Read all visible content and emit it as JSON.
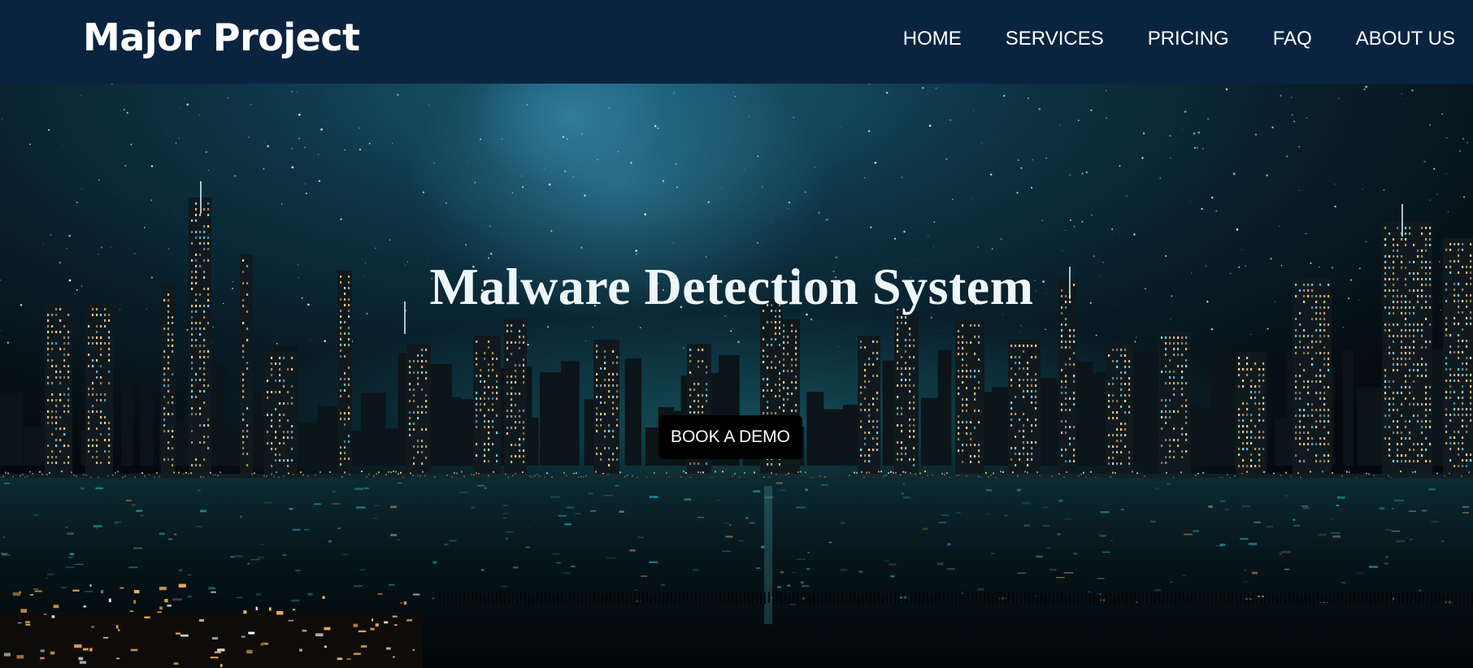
{
  "navbar": {
    "brand": "Major Project",
    "links": [
      {
        "label": "HOME"
      },
      {
        "label": "SERVICES"
      },
      {
        "label": "PRICING"
      },
      {
        "label": "FAQ"
      },
      {
        "label": "ABOUT US"
      }
    ]
  },
  "hero": {
    "title": "Malware Detection System",
    "cta_label": "BOOK A DEMO",
    "background_image": "night-city-skyline-photo"
  },
  "colors": {
    "navbar_bg": "#0a2440",
    "button_bg": "#000000",
    "text": "#ffffff"
  }
}
